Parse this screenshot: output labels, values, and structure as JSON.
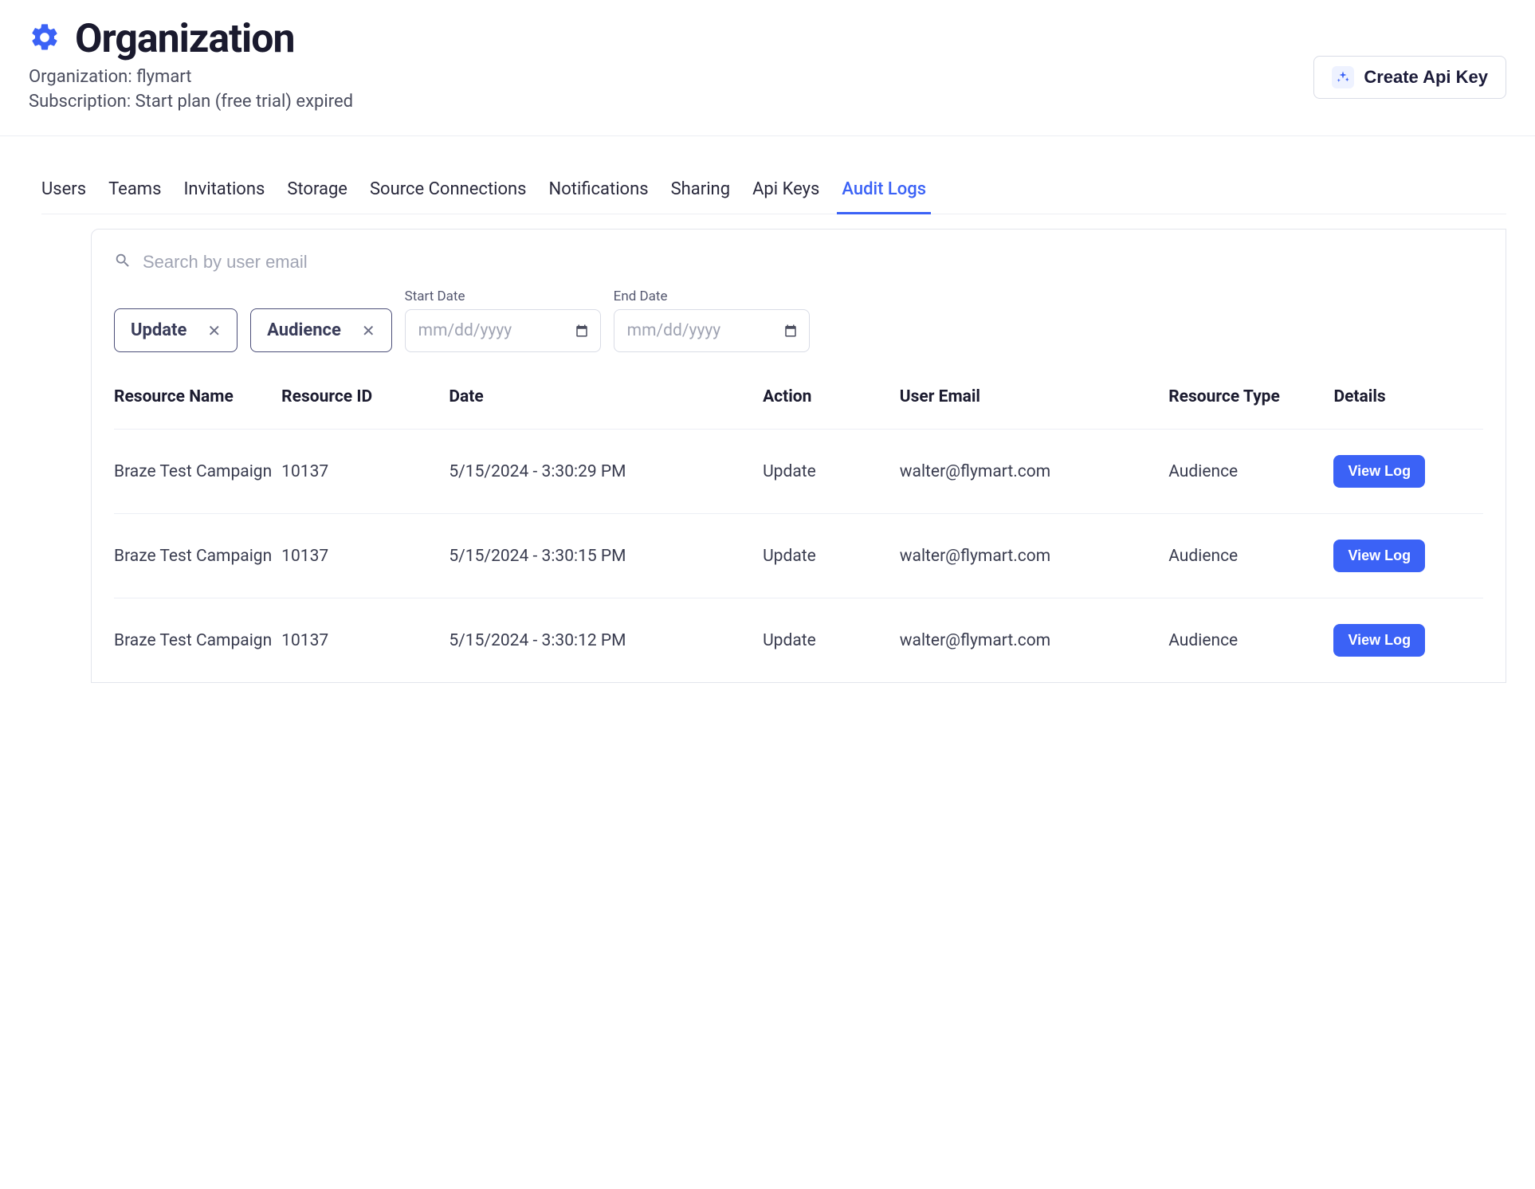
{
  "header": {
    "title": "Organization",
    "org_label": "Organization: ",
    "org_name": "flymart",
    "sub_label": "Subscription: ",
    "sub_value": "Start plan (free trial) expired",
    "create_btn": "Create Api Key"
  },
  "tabs": [
    "Users",
    "Teams",
    "Invitations",
    "Storage",
    "Source Connections",
    "Notifications",
    "Sharing",
    "Api Keys",
    "Audit Logs"
  ],
  "active_tab_index": 8,
  "search": {
    "placeholder": "Search by user email"
  },
  "filters": {
    "chips": [
      "Update",
      "Audience"
    ],
    "start_date_label": "Start Date",
    "end_date_label": "End Date",
    "date_placeholder": "mm/dd/yyyy"
  },
  "table": {
    "headers": [
      "Resource Name",
      "Resource ID",
      "Date",
      "Action",
      "User Email",
      "Resource Type",
      "Details"
    ],
    "view_label": "View Log",
    "rows": [
      {
        "name": "Braze Test Campaign",
        "id": "10137",
        "date": "5/15/2024 - 3:30:29 PM",
        "action": "Update",
        "email": "walter@flymart.com",
        "type": "Audience"
      },
      {
        "name": "Braze Test Campaign",
        "id": "10137",
        "date": "5/15/2024 - 3:30:15 PM",
        "action": "Update",
        "email": "walter@flymart.com",
        "type": "Audience"
      },
      {
        "name": "Braze Test Campaign",
        "id": "10137",
        "date": "5/15/2024 - 3:30:12 PM",
        "action": "Update",
        "email": "walter@flymart.com",
        "type": "Audience"
      }
    ]
  }
}
